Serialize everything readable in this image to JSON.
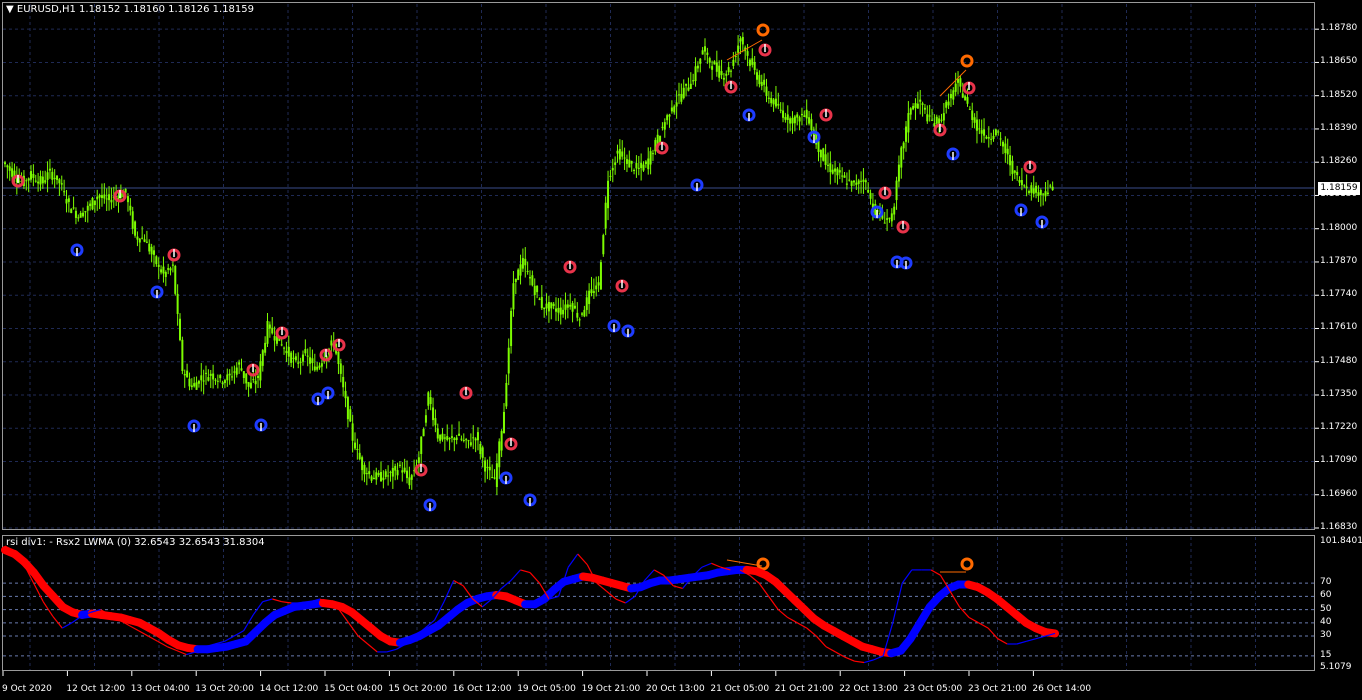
{
  "window": {
    "main_title": "▼ EURUSD,H1  1.18152 1.18160 1.18126 1.18159",
    "sub_title": "rsi div1: - Rsx2 LWMA (0) 32.6543 32.6543 31.8304"
  },
  "price_axis": {
    "labels": [
      "1.18780",
      "1.18650",
      "1.18520",
      "1.18390",
      "1.18260",
      "1.18130",
      "1.18000",
      "1.17870",
      "1.17740",
      "1.17610",
      "1.17480",
      "1.17350",
      "1.17220",
      "1.17090",
      "1.16960",
      "1.16830"
    ],
    "current": "1.18159",
    "range": [
      1.1683,
      1.18855
    ]
  },
  "sub_axis": {
    "labels": [
      "101.8401",
      "70",
      "60",
      "50",
      "40",
      "30",
      "15",
      "5.1079"
    ],
    "levels": [
      70,
      60,
      50,
      40,
      30,
      15
    ],
    "range": [
      5.1079,
      101.8401
    ]
  },
  "time_axis": {
    "labels": [
      "9 Oct 2020",
      "12 Oct 12:00",
      "13 Oct 04:00",
      "13 Oct 20:00",
      "14 Oct 12:00",
      "15 Oct 04:00",
      "15 Oct 20:00",
      "16 Oct 12:00",
      "19 Oct 05:00",
      "19 Oct 21:00",
      "20 Oct 13:00",
      "21 Oct 05:00",
      "21 Oct 21:00",
      "22 Oct 13:00",
      "23 Oct 05:00",
      "23 Oct 21:00",
      "26 Oct 14:00"
    ]
  },
  "colors": {
    "candles": "#7cfc00",
    "grid": "#1f2a55",
    "signal_up": "#e8334a",
    "signal_down": "#1e3cff",
    "divergence": "#ff6a00",
    "rsx_up": "#0000ff",
    "rsx_down": "#ff0000",
    "level_line": "#6a7bb0"
  },
  "chart_data": {
    "type": "line",
    "title": "EURUSD,H1",
    "series": [
      {
        "name": "EURUSD",
        "values": [
          1.1826,
          1.1822,
          1.1818,
          1.1821,
          1.1818,
          1.1822,
          1.1818,
          1.1809,
          1.1805,
          1.1808,
          1.1813,
          1.1811,
          1.1813,
          1.1814,
          1.1797,
          1.1796,
          1.1788,
          1.1782,
          1.1785,
          1.1745,
          1.1738,
          1.1742,
          1.1743,
          1.1741,
          1.1742,
          1.1747,
          1.1738,
          1.1742,
          1.1762,
          1.1757,
          1.1752,
          1.1747,
          1.1751,
          1.1745,
          1.175,
          1.1756,
          1.1737,
          1.1718,
          1.1707,
          1.1703,
          1.1703,
          1.1704,
          1.1707,
          1.1701,
          1.1711,
          1.1735,
          1.1719,
          1.1717,
          1.1719,
          1.1716,
          1.1719,
          1.1707,
          1.1701,
          1.1729,
          1.1779,
          1.1787,
          1.1778,
          1.177,
          1.1769,
          1.1768,
          1.1771,
          1.1765,
          1.1774,
          1.1778,
          1.182,
          1.183,
          1.1826,
          1.1823,
          1.1825,
          1.1833,
          1.1842,
          1.1849,
          1.1854,
          1.1859,
          1.187,
          1.1864,
          1.186,
          1.1863,
          1.1875,
          1.1865,
          1.1858,
          1.1851,
          1.1847,
          1.1843,
          1.1843,
          1.1845,
          1.1834,
          1.1825,
          1.1822,
          1.1819,
          1.1817,
          1.182,
          1.1808,
          1.1804,
          1.1804,
          1.183,
          1.1848,
          1.1849,
          1.1842,
          1.1842,
          1.185,
          1.1857,
          1.1848,
          1.184,
          1.1836,
          1.1838,
          1.183,
          1.1821,
          1.1817,
          1.1815,
          1.1814,
          1.1816
        ]
      },
      {
        "name": "Rsx2 LWMA",
        "values": [
          95,
          92,
          86,
          78,
          68,
          60,
          52,
          48,
          46,
          47,
          46,
          45,
          44,
          42,
          40,
          36,
          32,
          27,
          23,
          21,
          20,
          20,
          21,
          22,
          24,
          26,
          33,
          40,
          46,
          49,
          52,
          53,
          54,
          55,
          54,
          52,
          48,
          42,
          36,
          30,
          26,
          25,
          27,
          30,
          34,
          38,
          44,
          50,
          55,
          58,
          60,
          61,
          60,
          57,
          54,
          54,
          58,
          65,
          71,
          73,
          75,
          74,
          72,
          70,
          68,
          66,
          67,
          70,
          72,
          72,
          73,
          74,
          75,
          76,
          78,
          79,
          80,
          80,
          79,
          76,
          71,
          64,
          57,
          50,
          43,
          38,
          34,
          30,
          26,
          22,
          20,
          18,
          17,
          19,
          28,
          40,
          52,
          60,
          66,
          69,
          69,
          67,
          63,
          58,
          52,
          46,
          40,
          36,
          33,
          32
        ]
      },
      {
        "name": "RSX",
        "values": [
          98,
          94,
          84,
          70,
          56,
          45,
          36,
          40,
          45,
          48,
          50,
          46,
          42,
          38,
          34,
          30,
          26,
          22,
          19,
          16,
          18,
          22,
          24,
          26,
          30,
          34,
          46,
          56,
          58,
          56,
          55,
          55,
          56,
          58,
          55,
          50,
          40,
          30,
          24,
          18,
          18,
          20,
          24,
          30,
          36,
          42,
          56,
          72,
          68,
          58,
          52,
          58,
          66,
          72,
          80,
          78,
          70,
          58,
          60,
          82,
          92,
          84,
          70,
          64,
          58,
          55,
          60,
          72,
          80,
          76,
          68,
          66,
          75,
          82,
          85,
          82,
          80,
          80,
          76,
          70,
          60,
          50,
          44,
          40,
          36,
          30,
          22,
          18,
          14,
          11,
          10,
          12,
          15,
          40,
          70,
          80,
          80,
          80,
          76,
          64,
          52,
          44,
          40,
          36,
          28,
          24,
          24,
          26,
          28,
          30,
          32
        ]
      }
    ],
    "levels": [
      70,
      60,
      50,
      40,
      30,
      15
    ],
    "ylim": [
      1.1683,
      1.18855
    ],
    "sub_ylim": [
      5.1079,
      101.8401
    ]
  }
}
